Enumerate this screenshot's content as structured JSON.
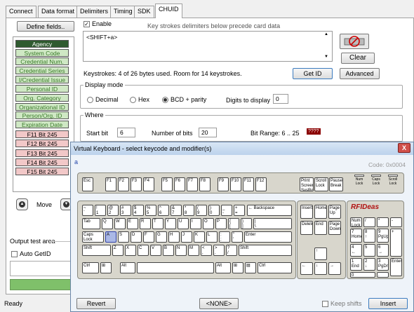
{
  "tabs": [
    "Connect",
    "Data format",
    "Delimiters",
    "Timing",
    "SDK",
    "CHUID"
  ],
  "left": {
    "define_button": "Define fields..",
    "fields": [
      {
        "label": "Agency",
        "style": "dark"
      },
      {
        "label": "System Code",
        "style": "green"
      },
      {
        "label": "Credential Num.",
        "style": "green"
      },
      {
        "label": "Credential Series",
        "style": "green"
      },
      {
        "label": "I/Credential Issue",
        "style": "green"
      },
      {
        "label": "Personal ID",
        "style": "green"
      },
      {
        "label": "Org. Category",
        "style": "green"
      },
      {
        "label": "Organizational ID",
        "style": "green"
      },
      {
        "label": "Person/Org. ID",
        "style": "green"
      },
      {
        "label": "Expiration Date",
        "style": "green"
      },
      {
        "label": "F11 Bit 245",
        "style": "pink"
      },
      {
        "label": "F12 Bit 245",
        "style": "pink"
      },
      {
        "label": "F13 Bit 245",
        "style": "pink"
      },
      {
        "label": "F14 Bit 245",
        "style": "pink"
      },
      {
        "label": "F15 Bit 245",
        "style": "pink"
      }
    ],
    "move_label": "Move",
    "output_test_area": "Output test area",
    "auto_getid": "Auto GetID"
  },
  "main": {
    "enable_label": "Enable",
    "hint": "Key strokes delimiters below precede card data",
    "keystroke_text": "<SHIFT+a>",
    "clear": "Clear",
    "status": "Keystrokes: 4 of 26 bytes used. Room for 14 keystrokes.",
    "get_id": "Get ID",
    "advanced": "Advanced",
    "display_mode": "Display mode",
    "modes": [
      "Decimal",
      "Hex",
      "BCD + parity"
    ],
    "selected_mode": "BCD + parity",
    "digits_label": "Digits to display",
    "digits_value": "0",
    "where": "Where",
    "start_bit_label": "Start bit",
    "start_bit_value": "6",
    "num_bits_label": "Number of bits",
    "num_bits_value": "20",
    "bit_range": "Bit Range: 6 .. 25",
    "bit_badge": "????"
  },
  "ready": "Ready",
  "dialog": {
    "title": "Virtual Keyboard - select keycode and modifier(s)",
    "close": "X",
    "key_char": "a",
    "code": "Code: 0x0004",
    "revert": "Revert",
    "none": "<NONE>",
    "keep_shifts": "Keep shifts",
    "insert": "Insert",
    "logo": "RFIDeas",
    "leds": [
      "Num\nLock",
      "Caps\nLock",
      "Scroll\nLock"
    ],
    "keys": {
      "fn": [
        "Esc",
        "F1",
        "F2",
        "F3",
        "F4",
        "F5",
        "F6",
        "F7",
        "F8",
        "F9",
        "F10",
        "F11",
        "F12",
        "Print\nScreen\nSysRq",
        "Scroll\nLock",
        "Pause\nBreak"
      ],
      "row1": [
        "~\n`",
        "!\n1",
        "@\n2",
        "#\n3",
        "$\n4",
        "%\n5",
        "^\n6",
        "&\n7",
        "*\n8",
        "(\n9",
        ")\n0",
        "_\n-",
        "+\n=",
        "← Backspace"
      ],
      "row2": [
        "Tab",
        "Q",
        "W",
        "E",
        "R",
        "T",
        "Y",
        "U",
        "I",
        "O",
        "P",
        "{\n[",
        "}\n]",
        "|\n\\"
      ],
      "row3": [
        "Caps Lock",
        "A",
        "S",
        "D",
        "F",
        "G",
        "H",
        "J",
        "K",
        "L",
        ":\n;",
        "\"\n'",
        "Enter"
      ],
      "row4": [
        "Shift",
        "Z",
        "X",
        "C",
        "V",
        "B",
        "N",
        "M",
        "<\n,",
        ">\n.",
        "?\n/",
        "Shift"
      ],
      "row5": [
        "Ctrl",
        "⊞",
        "Alt",
        "",
        "Alt",
        "⊞",
        "▤",
        "Ctrl"
      ],
      "nav": [
        "Insert",
        "Home",
        "Page\nUp",
        "Delete",
        "End",
        "Page\nDown"
      ],
      "arrows": [
        "↑",
        "←",
        "↓",
        "→"
      ],
      "numpad": [
        "Num\nLock",
        "/",
        "*",
        "-",
        "7\nHome",
        "8\n↑",
        "9\nPgUp",
        "+",
        "4\n←",
        "5",
        "6\n→",
        "1\nEnd",
        "2\n↓",
        "3\nPgDn",
        "Enter",
        "0\nIns",
        ".\nDel"
      ]
    }
  },
  "colors": {
    "selected_key": "#aab8e6",
    "badge": "#8b0000",
    "dialog_title": "#c9dbf0",
    "progress": "#7fc06a"
  }
}
